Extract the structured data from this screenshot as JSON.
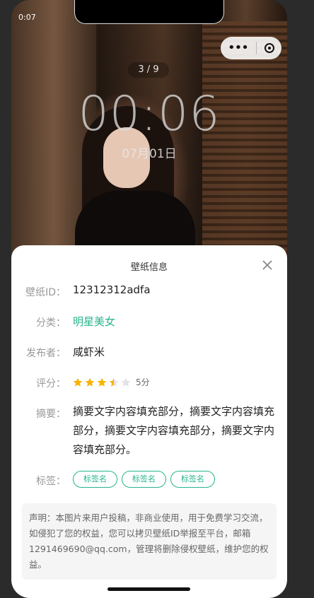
{
  "status": {
    "time": "0:07"
  },
  "capsule": {
    "more_icon": "more-dots-icon",
    "close_icon": "target-circle-icon"
  },
  "wallpaper": {
    "counter": "3 / 9",
    "clock": "00:06",
    "date": "07月01日"
  },
  "info": {
    "title": "壁纸信息",
    "id_label": "壁纸ID：",
    "id_value": "12312312adfa",
    "category_label": "分类：",
    "category_value": "明星美女",
    "publisher_label": "发布者：",
    "publisher_value": "咸虾米",
    "rating_label": "评分：",
    "rating_value": 3.5,
    "rating_max": 5,
    "rating_text": "5分",
    "summary_label": "摘要：",
    "summary_value": "摘要文字内容填充部分，摘要文字内容填充部分，摘要文字内容填充部分，摘要文字内容填充部分。",
    "tags_label": "标签：",
    "tags": [
      "标签名",
      "标签名",
      "标签名"
    ],
    "notice": "声明：本图片来用户投稿，非商业使用，用于免费学习交流，如侵犯了您的权益，您可以拷贝壁纸ID举报至平台，邮箱1291469690@qq.com，管理将删除侵权壁纸，维护您的权益。"
  },
  "colors": {
    "accent": "#28b38c",
    "star": "#f7b500"
  }
}
